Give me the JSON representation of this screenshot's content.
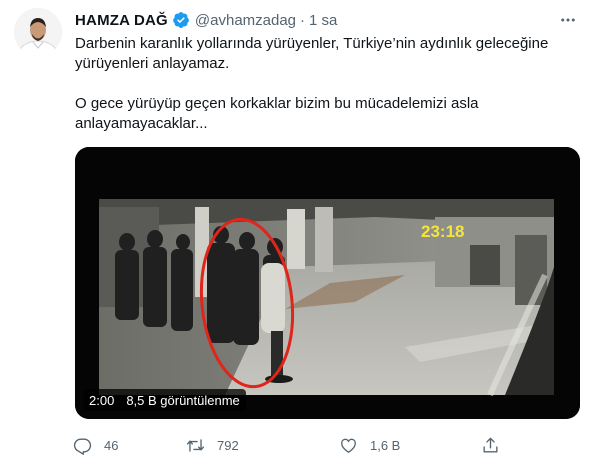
{
  "tweet": {
    "author_name": "HAMZA DAĞ",
    "handle": "@avhamzadag",
    "separator": "·",
    "time": "1 sa",
    "paragraphs": [
      "Darbenin karanlık yollarında yürüyenler, Türkiye’nin aydınlık geleceğine yürüyenleri anlayamaz.",
      "O gece yürüyüp geçen korkaklar bizim bu mücadelemizi asla anlayamayacaklar..."
    ]
  },
  "video": {
    "timestamp_overlay": "23:18",
    "duration": "2:00",
    "views": "8,5 B görüntülenme"
  },
  "actions": {
    "reply_count": "46",
    "retweet_count": "792",
    "like_count": "1,6 B"
  },
  "icons": {
    "avatar": "avatar-photo",
    "verified": "verified-badge-icon",
    "more": "more-dots-icon",
    "reply": "reply-icon",
    "retweet": "retweet-icon",
    "like": "heart-icon",
    "share": "share-icon"
  },
  "colors": {
    "text": "#0f1419",
    "secondary": "#536471",
    "verified": "#1d9bf0",
    "highlight_circle": "#e0251b",
    "overlay_timestamp": "#f5e53a"
  }
}
